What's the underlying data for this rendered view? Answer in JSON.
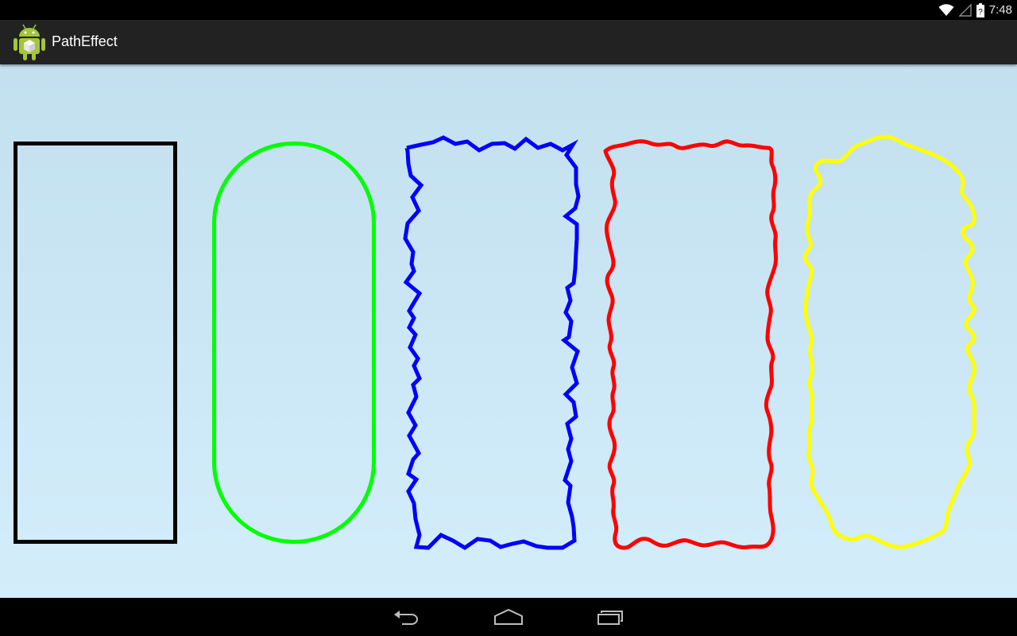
{
  "status_bar": {
    "time": "7:48",
    "icons": [
      "wifi-icon",
      "signal-icon",
      "battery-icon"
    ]
  },
  "action_bar": {
    "app_icon": "android-icon",
    "title": "PathEffect"
  },
  "canvas": {
    "background": [
      "#c3e0ef",
      "#d3edfb"
    ],
    "paths": [
      {
        "effect": "none",
        "color": "#000000"
      },
      {
        "effect": "corner",
        "color": "#00ff00"
      },
      {
        "effect": "discrete",
        "color": "#0000ff"
      },
      {
        "effect": "discrete-corner",
        "color": "#ff0000"
      },
      {
        "effect": "discrete-corner",
        "color": "#ffff00"
      }
    ]
  },
  "nav_bar": {
    "buttons": [
      "back-icon",
      "home-icon",
      "recent-apps-icon"
    ]
  }
}
